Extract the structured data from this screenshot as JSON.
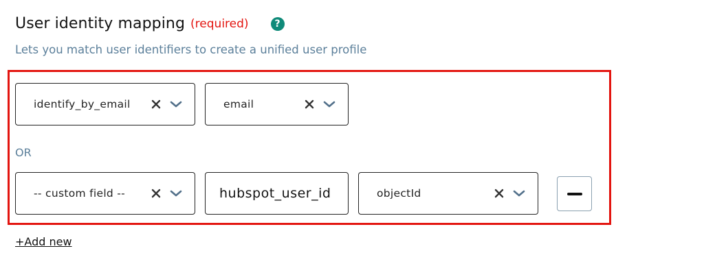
{
  "header": {
    "title": "User identity mapping",
    "required_label": "(required)",
    "help_icon": "question-circle-icon",
    "help_glyph": "?",
    "subtitle": "Lets you match user identifiers to create a unified user profile"
  },
  "rows": [
    {
      "left_select": {
        "value": "identify_by_email"
      },
      "right_select": {
        "value": "email"
      }
    },
    {
      "left_select": {
        "value": "-- custom field --"
      },
      "text_input": {
        "value": "hubspot_user_id"
      },
      "right_select": {
        "value": "objectId"
      },
      "remove_icon": "minus-icon"
    }
  ],
  "separator_label": "OR",
  "add_new_label": "+Add new",
  "colors": {
    "required": "#e3140f",
    "help_bg": "#0f8a79",
    "muted": "#5b7f9a",
    "highlight_frame": "#e3140f"
  }
}
